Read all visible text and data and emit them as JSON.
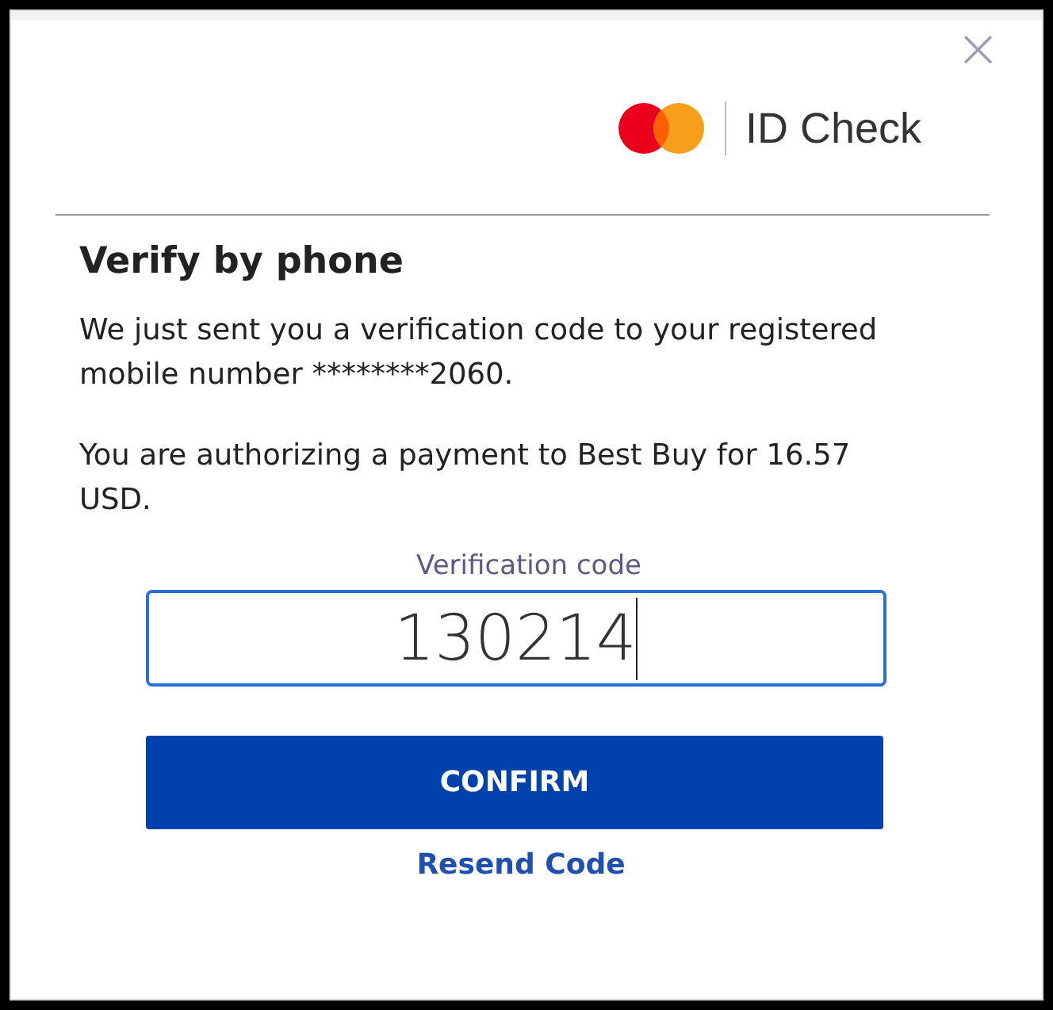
{
  "brand": {
    "name": "ID Check"
  },
  "close_button": {
    "label": "×"
  },
  "title": "Verify by phone",
  "paragraphs": [
    "We just sent you a verification code to your registered mobile number ********2060.",
    "You are authorizing a payment to Best Buy for 16.57 USD."
  ],
  "code_field": {
    "label": "Verification code",
    "value": "130214",
    "focused": true
  },
  "buttons": [
    {
      "label": "CONFIRM",
      "kind": "primary"
    },
    {
      "label": "Resend Code",
      "kind": "link"
    }
  ]
}
